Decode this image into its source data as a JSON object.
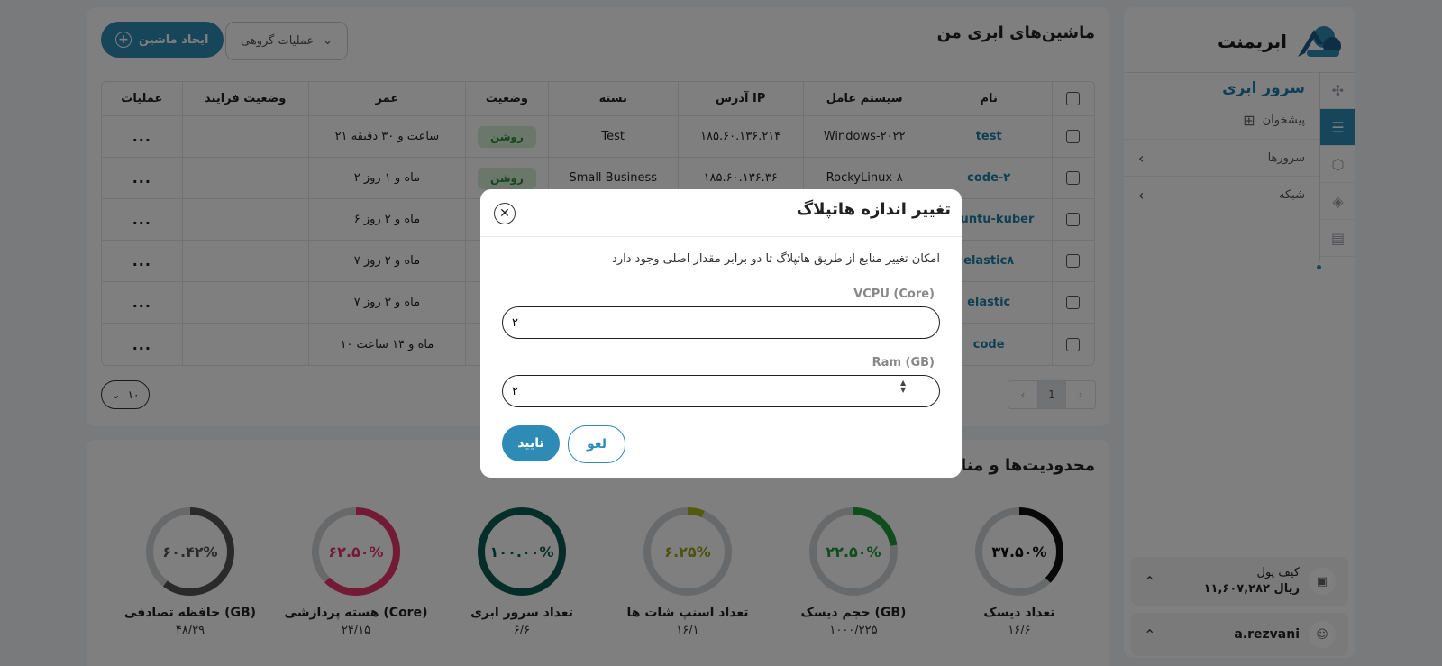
{
  "brand": {
    "name": "ابریمنت"
  },
  "sidebar": {
    "section_title": "سرور ابری",
    "dashboard": "پیشخوان",
    "menu": [
      {
        "label": "سرورها"
      },
      {
        "label": "شبکه"
      }
    ],
    "wallet": {
      "label": "کیف پول",
      "amount": "۱۱,۶۰۷,۲۸۲ ریال"
    },
    "user": {
      "name": "a.rezvani"
    }
  },
  "main": {
    "title": "ماشین‌های ابری من",
    "create_button": "ایجاد ماشین",
    "bulk_button": "عملیات گروهی",
    "columns": [
      "نام",
      "سیستم عامل",
      "آدرس IP",
      "بسته",
      "وضعیت",
      "عمر",
      "وضعیت فرایند",
      "عملیات"
    ],
    "rows": [
      {
        "name": "test",
        "os": "Windows-۲۰۲۲",
        "ip": "۱۸۵.۶۰.۱۳۶.۲۱۴",
        "package": "Test",
        "status": "روشن",
        "age": "۲۱ ساعت و ۳۰ دقیقه",
        "process": "",
        "ops": "..."
      },
      {
        "name": "code-۲",
        "os": "RockyLinux-۸",
        "ip": "۱۸۵.۶۰.۱۳۶.۳۶",
        "package": "Small Business",
        "status": "روشن",
        "age": "۲ ماه و ۱ روز",
        "process": "",
        "ops": "..."
      },
      {
        "name": "ubuntu-kuber",
        "os": "",
        "ip": "",
        "package": "",
        "status": "",
        "age": "۶ ماه و ۲ روز",
        "process": "",
        "ops": "..."
      },
      {
        "name": "elastic۸",
        "os": "",
        "ip": "",
        "package": "",
        "status": "",
        "age": "۷ ماه و ۲ روز",
        "process": "",
        "ops": "..."
      },
      {
        "name": "elastic",
        "os": "",
        "ip": "",
        "package": "",
        "status": "",
        "age": "۷ ماه و ۳ روز",
        "process": "",
        "ops": "..."
      },
      {
        "name": "code",
        "os": "",
        "ip": "",
        "package": "",
        "status": "",
        "age": "۱۰ ماه و ۱۴ ساعت",
        "process": "",
        "ops": "..."
      }
    ],
    "pagination": {
      "current": "1",
      "prev": "‹",
      "next": "›"
    },
    "per_page": "۱۰"
  },
  "limits": {
    "title": "محدودیت‌ها و منابع",
    "gauges": [
      {
        "label": "تعداد دیسک",
        "percent_text": "۳۷.۵۰%",
        "percent": 37.5,
        "usage": "۱۶/۶",
        "color": "#111111"
      },
      {
        "label": "حجم دیسک (GB)",
        "percent_text": "۲۲.۵۰%",
        "percent": 22.5,
        "usage": "۱۰۰۰/۲۲۵",
        "color": "#1f9a3a"
      },
      {
        "label": "تعداد اسنپ شات ها",
        "percent_text": "۶.۲۵%",
        "percent": 6.25,
        "usage": "۱۶/۱",
        "color": "#a8b41a"
      },
      {
        "label": "تعداد سرور ابری",
        "percent_text": "۱۰۰.۰۰%",
        "percent": 100,
        "usage": "۶/۶",
        "color": "#0d5c50"
      },
      {
        "label": "هسته پردازشی (Core)",
        "percent_text": "۶۲.۵۰%",
        "percent": 62.5,
        "usage": "۲۴/۱۵",
        "color": "#e6356e"
      },
      {
        "label": "حافظه تصادفی (GB)",
        "percent_text": "۶۰.۴۲%",
        "percent": 60.42,
        "usage": "۴۸/۲۹",
        "color": "#555555"
      }
    ]
  },
  "modal": {
    "title": "تغییر اندازه هاتپلاگ",
    "description": "امکان تغییر منابع از طریق هاتپلاگ تا دو برابر مقدار اصلی وجود دارد",
    "vcpu_label": "VCPU (Core)",
    "vcpu_value": "۲",
    "ram_label": "Ram (GB)",
    "ram_value": "۲",
    "confirm": "تایید",
    "cancel": "لغو"
  },
  "colors": {
    "accent": "#2e8bb5",
    "overlay": "rgba(0,0,0,0.5)"
  }
}
